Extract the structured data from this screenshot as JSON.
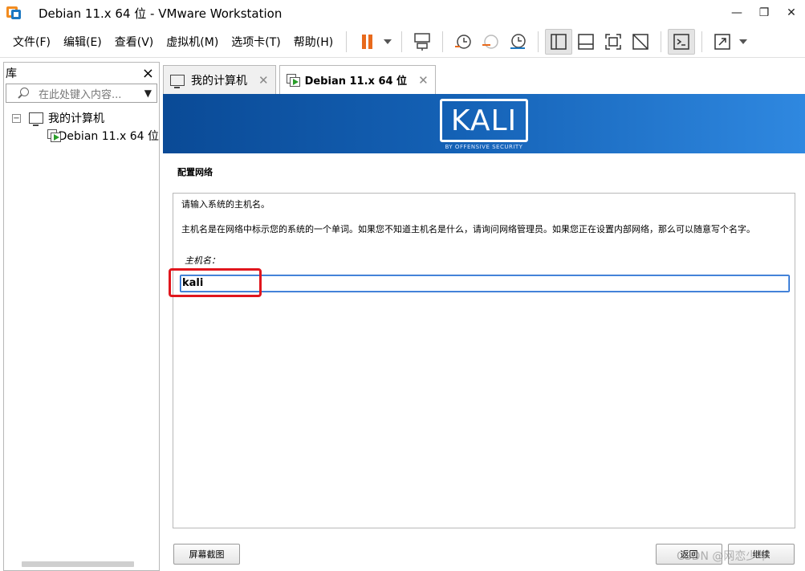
{
  "window": {
    "title": "Debian 11.x 64 位 - VMware Workstation",
    "controls": {
      "minimize": "—",
      "restore": "❐",
      "close": "✕"
    }
  },
  "menu": [
    "文件(F)",
    "编辑(E)",
    "查看(V)",
    "虚拟机(M)",
    "选项卡(T)",
    "帮助(H)"
  ],
  "library": {
    "title": "库",
    "close": "×",
    "search_placeholder": "在此处键入内容...",
    "search_dropdown": "▼",
    "tree": {
      "root": {
        "expander": "−",
        "label": "我的计算机"
      },
      "child": {
        "label": "Debian 11.x 64 位"
      }
    }
  },
  "tabs": [
    {
      "label": "我的计算机",
      "close": "✕",
      "icon": "monitor-icon"
    },
    {
      "label": "Debian 11.x 64 位",
      "close": "✕",
      "icon": "vm-icon"
    }
  ],
  "installer": {
    "brand": "KALI",
    "brand_sub": "BY OFFENSIVE SECURITY",
    "section_title": "配置网络",
    "prompt": "请输入系统的主机名。",
    "description": "主机名是在网络中标示您的系统的一个单词。如果您不知道主机名是什么，请询问网络管理员。如果您正在设置内部网络，那么可以随意写个名字。",
    "field_label": "主机名：",
    "hostname_value": "kali",
    "buttons": {
      "screenshot": "屏幕截图",
      "back": "返回",
      "continue": "继续"
    },
    "watermark": "CSDN @网恋少年"
  },
  "colors": {
    "banner_start": "#0a4a96",
    "banner_end": "#2f88e0",
    "pause_orange": "#e86a1c",
    "highlight_red": "#e0161d",
    "input_focus": "#1c63c8"
  }
}
